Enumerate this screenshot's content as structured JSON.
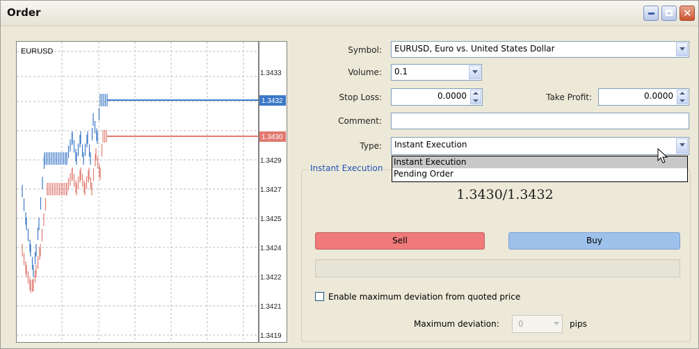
{
  "window": {
    "title": "Order"
  },
  "chart": {
    "symbol": "EURUSD",
    "price_labels": [
      "1.3433",
      "1.3432",
      "1.3430",
      "1.3430",
      "1.3429",
      "1.3427",
      "1.3425",
      "1.3424",
      "1.3422",
      "1.3421",
      "1.3419"
    ],
    "ask_marker": "1.3432",
    "bid_marker": "1.3430",
    "ask_color": "#3b78c8",
    "bid_color": "#e07a70"
  },
  "form": {
    "symbol_label": "Symbol:",
    "symbol_value": "EURUSD, Euro vs. United States Dollar",
    "volume_label": "Volume:",
    "volume_value": "0.1",
    "stoploss_label": "Stop Loss:",
    "stoploss_value": "0.0000",
    "takeprofit_label": "Take Profit:",
    "takeprofit_value": "0.0000",
    "comment_label": "Comment:",
    "comment_value": "",
    "type_label": "Type:",
    "type_value": "Instant Execution",
    "type_options": [
      "Instant Execution",
      "Pending Order"
    ]
  },
  "execution": {
    "group_title": "Instant Execution",
    "quote": "1.3430/1.3432",
    "sell_label": "Sell",
    "buy_label": "Buy",
    "deviation_checkbox_label": "Enable maximum deviation from quoted price",
    "deviation_checked": false,
    "max_deviation_label": "Maximum deviation:",
    "max_deviation_value": "0",
    "pips_label": "pips"
  },
  "colors": {
    "sell": "#f07a7a",
    "buy": "#9ec1ec",
    "group_title": "#1f53b8"
  }
}
